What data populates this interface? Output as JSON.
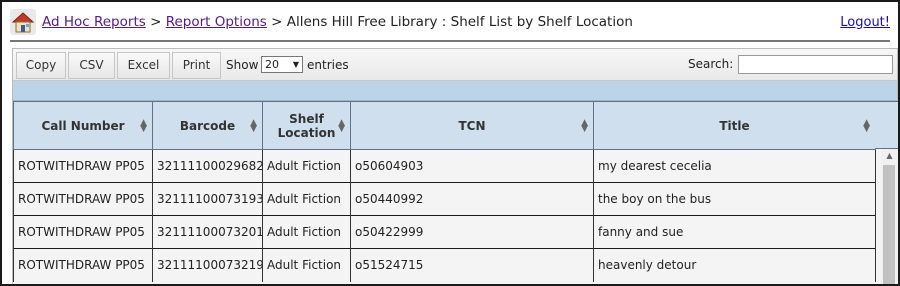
{
  "header": {
    "breadcrumb_link_1": "Ad Hoc Reports",
    "sep_1": " > ",
    "breadcrumb_link_2": "Report Options",
    "sep_2": " > ",
    "current": "Allens Hill Free Library : Shelf List by Shelf Location",
    "logout": "Logout!"
  },
  "toolbar": {
    "copy": "Copy",
    "csv": "CSV",
    "excel": "Excel",
    "print": "Print",
    "show": "Show",
    "entries_value": "20",
    "entries": "entries",
    "search": "Search:"
  },
  "table": {
    "columns": [
      "Call Number",
      "Barcode",
      "Shelf Location",
      "TCN",
      "Title"
    ],
    "rows": [
      [
        "ROTWITHDRAW PP05",
        "32111100029682",
        "Adult Fiction",
        "o50604903",
        "my dearest cecelia"
      ],
      [
        "ROTWITHDRAW PP05",
        "32111100073193",
        "Adult Fiction",
        "o50440992",
        "the boy on the bus"
      ],
      [
        "ROTWITHDRAW PP05",
        "32111100073201",
        "Adult Fiction",
        "o50422999",
        "fanny and sue"
      ],
      [
        "ROTWITHDRAW PP05",
        "32111100073219",
        "Adult Fiction",
        "o51524715",
        "heavenly detour"
      ]
    ]
  },
  "icons": {
    "home": "home-icon",
    "sort": "sort-icon",
    "dropdown": "chevron-down-icon",
    "scroll_up": "scroll-up-icon"
  },
  "colors": {
    "header_blue": "#cfdfed",
    "band_blue": "#bdd3e7",
    "link": "#551a8b"
  }
}
